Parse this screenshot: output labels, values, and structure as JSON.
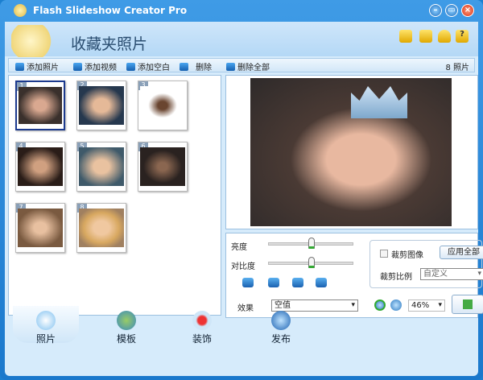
{
  "window": {
    "title": "Flash Slideshow Creator Pro"
  },
  "header": {
    "title": "收藏夹照片",
    "icons": [
      "folder-icon",
      "save-icon",
      "user-icon",
      "help-icon"
    ],
    "help_glyph": "?"
  },
  "toolbar": {
    "add_photo": "添加照片",
    "add_video": "添加视频",
    "add_blank": "添加空白",
    "delete": "删除",
    "delete_all": "删除全部",
    "count": "8 照片"
  },
  "thumbnails": [
    {
      "n": "1"
    },
    {
      "n": "2"
    },
    {
      "n": "3"
    },
    {
      "n": "4"
    },
    {
      "n": "5"
    },
    {
      "n": "6"
    },
    {
      "n": "7"
    },
    {
      "n": "8"
    }
  ],
  "controls": {
    "brightness_label": "亮度",
    "brightness": 0.5,
    "contrast_label": "对比度",
    "contrast": 0.5,
    "crop_label": "裁剪图像",
    "apply_all": "应用全部",
    "ratio_label": "裁剪比例",
    "ratio_value": "自定义",
    "effect_label": "效果",
    "effect_value": "空值",
    "zoom_value": "46%"
  },
  "tabs": [
    {
      "label": "照片"
    },
    {
      "label": "模板"
    },
    {
      "label": "装饰"
    },
    {
      "label": "发布"
    }
  ],
  "colors": {
    "frame": "#1a78cc",
    "panel": "#d6ebfb"
  }
}
